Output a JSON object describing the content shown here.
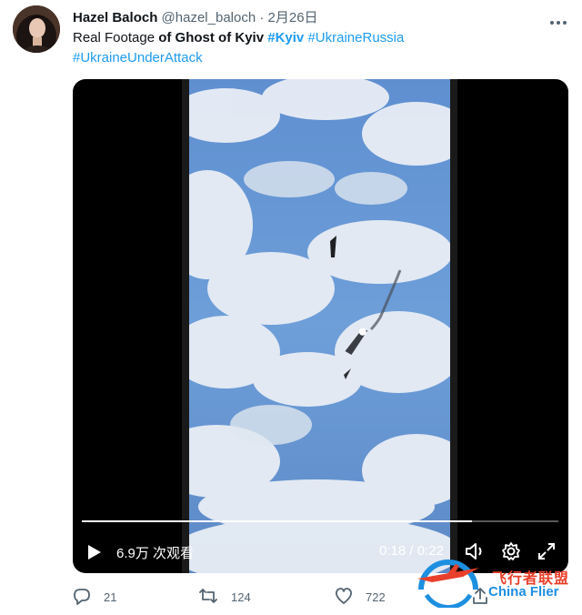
{
  "author": {
    "name": "Hazel Baloch",
    "handle": "@hazel_baloch",
    "separator": "·",
    "date": "2月26日"
  },
  "tweet": {
    "text_plain_1": "Real Footage ",
    "text_bold_1": "of Ghost of Kyiv",
    "hashtag_1": "#Kyiv",
    "hashtag_2": "#UkraineRussia",
    "hashtag_3": "#UkraineUnderAttack"
  },
  "video": {
    "views": "6.9万 次观看",
    "current_time": "0:18",
    "duration_sep": " / ",
    "duration": "0:22",
    "progress_fraction": 0.818
  },
  "actions": {
    "reply_count": "21",
    "retweet_count": "124",
    "like_count": "722"
  },
  "watermark": {
    "cn": "飞行者联盟",
    "en": "China Flier"
  },
  "colors": {
    "hashtag": "#1d9bf0",
    "muted": "#536471",
    "watermark_red": "#e8402b",
    "watermark_blue": "#1d8fe0"
  },
  "icons": [
    "more-icon",
    "play-icon",
    "volume-icon",
    "settings-icon",
    "fullscreen-icon",
    "reply-icon",
    "retweet-icon",
    "like-icon",
    "share-icon"
  ]
}
